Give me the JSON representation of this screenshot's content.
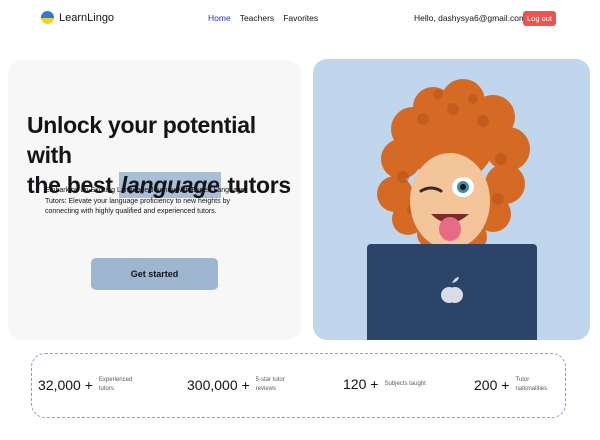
{
  "header": {
    "logo_text": "LearnLingo",
    "nav": [
      {
        "label": "Home",
        "active": true
      },
      {
        "label": "Teachers",
        "active": false
      },
      {
        "label": "Favorites",
        "active": false
      }
    ],
    "greeting": "Hello, dashysya6@gmail.com",
    "logout_label": "Log out"
  },
  "hero": {
    "title_line1": "Unlock your potential with",
    "title_pre": "the best",
    "title_highlight": "language",
    "title_post": "tutors",
    "description": "Embark on an Exciting Language Journey with Expert Language Tutors: Elevate your language proficiency to new heights by connecting with highly qualified and experienced tutors.",
    "cta_label": "Get started"
  },
  "stats": [
    {
      "number": "32,000 +",
      "label_line1": "Experienced",
      "label_line2": "tutors"
    },
    {
      "number": "300,000 +",
      "label_line1": "5-star tutor",
      "label_line2": "reviews"
    },
    {
      "number": "120 +",
      "label_line1": "Subjects taught",
      "label_line2": ""
    },
    {
      "number": "200 +",
      "label_line1": "Tutor",
      "label_line2": "nationalities"
    }
  ],
  "colors": {
    "accent": "#9fb6d0",
    "highlight": "#a9bfd8",
    "hero_bg": "#bfd6ec",
    "logout": "#ef5350",
    "nav_active": "#2432c8"
  },
  "icons": {
    "logo": "ukraine-flag-icon",
    "laptop": "apple-logo-icon"
  }
}
